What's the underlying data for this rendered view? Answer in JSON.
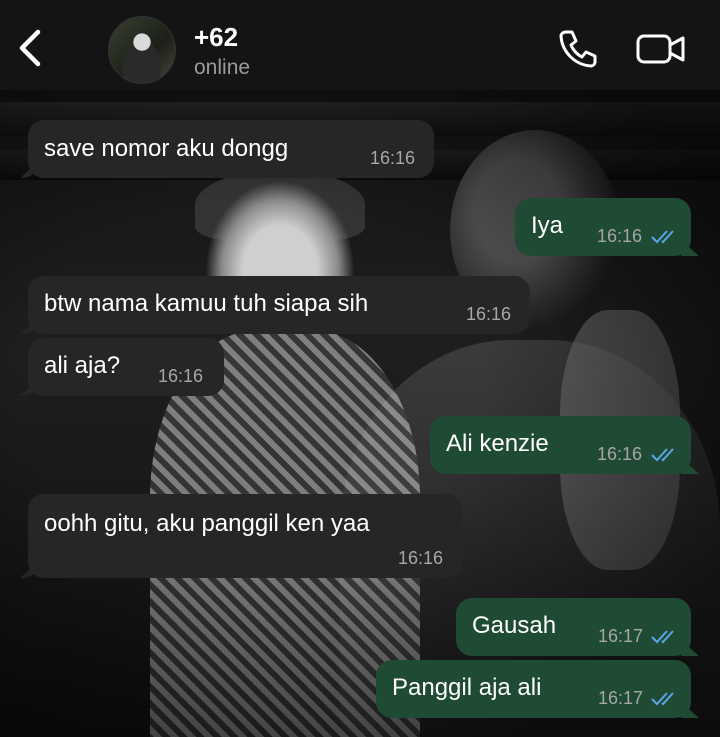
{
  "header": {
    "contact_name": "+62",
    "status": "online",
    "icons": [
      "chevron-left-icon",
      "phone-icon",
      "video-camera-icon"
    ]
  },
  "colors": {
    "header_bg": "#141414",
    "incoming_bubble": "#262626",
    "outgoing_bubble": "#1f4a33",
    "read_ticks": "#5aa6e8",
    "timestamp": "#a7a7a7"
  },
  "messages": [
    {
      "direction": "incoming",
      "text": "save nomor aku dongg",
      "time": "16:16"
    },
    {
      "direction": "outgoing",
      "text": "Iya",
      "time": "16:16",
      "read": true
    },
    {
      "direction": "incoming",
      "text": "btw nama kamuu tuh siapa sih",
      "time": "16:16"
    },
    {
      "direction": "incoming",
      "text": "ali aja?",
      "time": "16:16"
    },
    {
      "direction": "outgoing",
      "text": "Ali kenzie",
      "time": "16:16",
      "read": true
    },
    {
      "direction": "incoming",
      "text": "oohh gitu, aku panggil ken yaa",
      "time": "16:16"
    },
    {
      "direction": "outgoing",
      "text": "Gausah",
      "time": "16:17",
      "read": true
    },
    {
      "direction": "outgoing",
      "text": "Panggil aja ali",
      "time": "16:17",
      "read": true
    }
  ]
}
